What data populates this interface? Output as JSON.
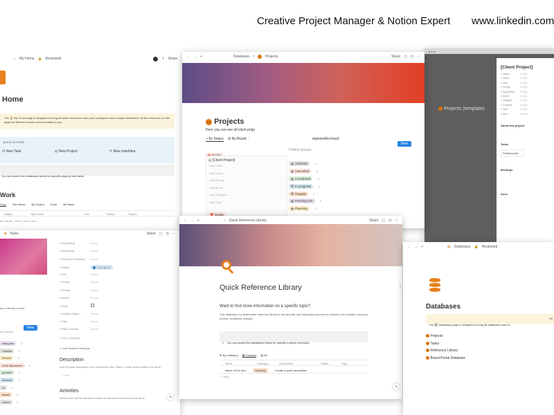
{
  "header": {
    "title": "Creative Project Manager & Notion Expert",
    "url": "www.linkedin.com/"
  },
  "home": {
    "breadcrumb_home": "My Home",
    "breadcrumb_restricted": "Restricted",
    "share": "Share",
    "title": "Home",
    "callout": "The 🏠 My Home page is designed to bring all active resources from your workspace into a simple dashboard. All the resources on this page are filtered to show content related to you.",
    "quick_actions_label": "QUICK ACTIONS",
    "actions": [
      "New Task",
      "New Project",
      "New note/idea"
    ],
    "search_hint": "You can search the databases below for specific projects and tasks",
    "work_title": "Work",
    "tabs": [
      "oday",
      "This Week",
      "By Project",
      "Done",
      "All Tasks"
    ],
    "columns": [
      "Status",
      "Task name",
      "Due",
      "Priority",
      "Project"
    ],
    "filter_hint": "ter results. Click to add a new"
  },
  "projects": {
    "breadcrumb_db": "Databases",
    "breadcrumb_page": "Projects",
    "share": "Share",
    "title": "Projects",
    "desc": "Here you can see all client proje",
    "views": [
      "By Status",
      "By Brand"
    ],
    "archived_view": "mpleted/Archived",
    "new_label": "New",
    "scope_label": "Scope",
    "scope_count": "1",
    "card_title": "[Client Project]",
    "card_props": [
      "Add Lead",
      "Add Dates",
      "Add Priority",
      "Add Brand",
      "Add Category",
      "Add Type"
    ],
    "card_tag": "Scope",
    "hidden_groups_label": "Hidden groups",
    "groups": [
      {
        "name": "Archived",
        "count": "0",
        "bg": "#e3e2e0"
      },
      {
        "name": "Cancelled",
        "count": "0",
        "bg": "#ffe2dd"
      },
      {
        "name": "Completed",
        "count": "0",
        "bg": "#dbeddb"
      },
      {
        "name": "In progress",
        "count": "0",
        "bg": "#d3e5ef"
      },
      {
        "name": "Paused",
        "count": "0",
        "bg": "#fadec9"
      },
      {
        "name": "Pending info",
        "count": "0",
        "bg": "#e8deee"
      },
      {
        "name": "Planning",
        "count": "0",
        "bg": "#fdecc8"
      }
    ]
  },
  "template": {
    "title": "[Client Project]",
    "bg_title": "Projects (template)",
    "props": [
      "Status",
      "Dates",
      "Lead",
      "Priority",
      "Supporting",
      "Brand",
      "Category",
      "Contacts",
      "Type",
      "Files"
    ],
    "prop_value": "Empty",
    "about": "About this project",
    "tasks": "Tasks",
    "pending": "Pending info",
    "meetings": "Meetings",
    "docs": "Docs"
  },
  "tasks": {
    "breadcrumb": "Tasks",
    "share": "Share",
    "props": [
      "Supporting",
      "Reviewing",
      "External Contractor",
      "Status",
      "Due",
      "Project",
      "Priority",
      "Brand",
      "Done",
      "Content Calen...",
      "Type",
      "Files & media"
    ],
    "status_value": "In progress",
    "empty": "Empty",
    "add_property": "Add a property",
    "related": "Add Related Meetings",
    "description_title": "Description",
    "description_hint": "Add the task description and references here. Make it clear what needs to be done.",
    "list_item": "List",
    "activities_title": "Activities",
    "activities_hint": "Break down all the activities related to this task that needs to be done.",
    "left_hint": "ay to identify across",
    "new_label": "New",
    "hidden_label": "len groups",
    "left_groups": [
      {
        "name": "nding info",
        "count": "0",
        "bg": "#e8deee"
      },
      {
        "name": "t started",
        "count": "0",
        "bg": "#e3e2e0"
      },
      {
        "name": "Review",
        "count": "0",
        "bg": "#fdecc8"
      },
      {
        "name": "eeds Adjustment",
        "count": "0",
        "bg": "#ffe2dd"
      },
      {
        "name": "pproved",
        "count": "0",
        "bg": "#dbeddb"
      },
      {
        "name": "elivered",
        "count": "0",
        "bg": "#d3e5ef"
      },
      {
        "name": "ne",
        "count": "0",
        "bg": "#e3e2e0"
      },
      {
        "name": "aused",
        "count": "0",
        "bg": "#fadec9"
      },
      {
        "name": "chived",
        "count": "0",
        "bg": "#e3e2e0"
      }
    ]
  },
  "library": {
    "breadcrumb": "Quick Reference Library",
    "share": "Share",
    "title": "Quick Reference Library",
    "question": "Want to find more information on a specific topic?",
    "desc": "This database is a searchable reference library to find specific and frequently used terms related to the industry, acronym, brands, workflows, designs",
    "search_hint": "You can search the databases below for specific projects and tasks",
    "tabs": [
      "By Category",
      "Glossary",
      "All"
    ],
    "columns": [
      "Name",
      "Category",
      "Description",
      "Status",
      "Tags"
    ],
    "row": {
      "name": "Name of the item",
      "category": "Glossary",
      "description": "Create a quick description"
    },
    "new_row": "New"
  },
  "databases": {
    "breadcrumb": "Databases",
    "restricted": "Restricted",
    "title": "Databases",
    "callout": "The 🗄 Databases page is designed to bring all databases used in",
    "callout_tail": "So",
    "items": [
      "Projects",
      "Tasks",
      "Reference Library",
      "Brand Portal Database"
    ]
  }
}
